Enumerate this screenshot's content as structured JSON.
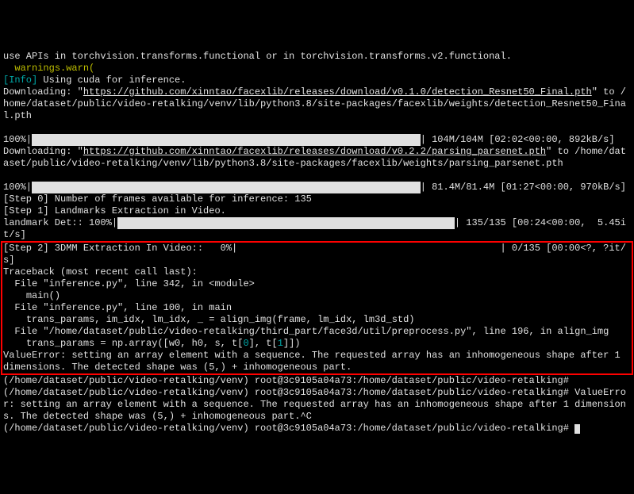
{
  "line_warn1": "use APIs in torchvision.transforms.functional or in torchvision.transforms.v2.functional.",
  "line_warn2": "  warnings.warn(",
  "info_tag": "[Info]",
  "info_rest": " Using cuda for inference.",
  "dl1_pre": "Downloading: \"",
  "dl1_url": "https://github.com/xinntao/facexlib/releases/download/v0.1.0/detection_Resnet50_Final.pth",
  "dl1_post": "\" to /home/dataset/public/video-retalking/venv/lib/python3.8/site-packages/facexlib/weights/detection_Resnet50_Final.pth",
  "prog1_left": "100%|",
  "prog1_bar": "████████████████████████████████████████████████████████████████████",
  "prog1_right": "| 104M/104M [02:02<00:00, 892kB/s]",
  "dl2_pre": "Downloading: \"",
  "dl2_url": "https://github.com/xinntao/facexlib/releases/download/v0.2.2/parsing_parsenet.pth",
  "dl2_post": "\" to /home/dataset/public/video-retalking/venv/lib/python3.8/site-packages/facexlib/weights/parsing_parsenet.pth",
  "prog2_left": "100%|",
  "prog2_bar": "████████████████████████████████████████████████████████████████████",
  "prog2_right": "| 81.4M/81.4M [01:27<00:00, 970kB/s]",
  "step0": "[Step 0] Number of frames available for inference: 135",
  "step1": "[Step 1] Landmarks Extraction in Video.",
  "landmark_left": "landmark Det:: 100%|",
  "landmark_bar": "███████████████████████████████████████████████████████████",
  "landmark_right": "| 135/135 [00:24<00:00,  5.45it/s]",
  "step2": "[Step 2] 3DMM Extraction In Video::   0%|",
  "step2_right": "| 0/135 [00:00<?, ?it/s]",
  "traceback": "Traceback (most recent call last):",
  "tb_f1": "  File \"inference.py\", line 342, in <module>",
  "tb_c1": "    main()",
  "tb_f2": "  File \"inference.py\", line 100, in main",
  "tb_c2": "    trans_params, im_idx, lm_idx, _ = align_img(frame, lm_idx, lm3d_std)",
  "tb_f3": "  File \"/home/dataset/public/video-retalking/third_part/face3d/util/preprocess.py\", line 196, in align_img",
  "tb_c3a": "    trans_params = np.array([w0, h0, s, t[",
  "tb_c3b": "], t[",
  "tb_c3c": "]])",
  "idx0": "0",
  "idx1": "1",
  "valerr": "ValueError: setting an array element with a sequence. The requested array has an inhomogeneous shape after 1 dimensions. The detected shape was (5,) + inhomogeneous part.",
  "prompt1": "(/home/dataset/public/video-retalking/venv) root@3c9105a04a73:/home/dataset/public/video-retalking#",
  "prompt2": "(/home/dataset/public/video-retalking/venv) root@3c9105a04a73:/home/dataset/public/video-retalking# ValueError: setting an array element with a sequence. The requested array has an inhomogeneous shape after 1 dimensions. The detected shape was (5,) + inhomogeneous part.^C",
  "prompt3": "(/home/dataset/public/video-retalking/venv) root@3c9105a04a73:/home/dataset/public/video-retalking# "
}
